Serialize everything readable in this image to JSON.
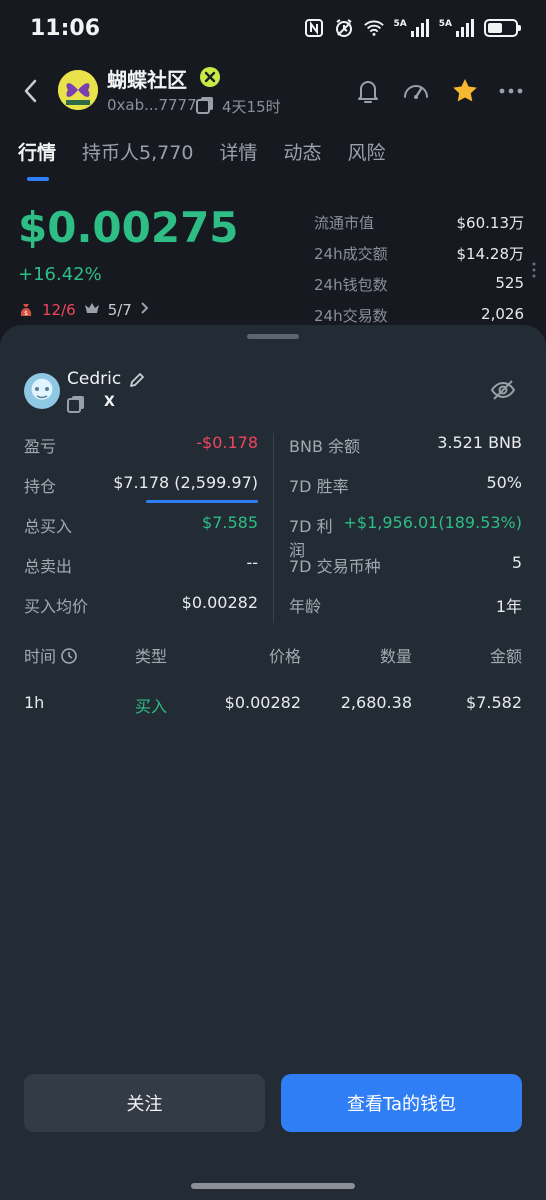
{
  "status_bar": {
    "time": "11:06",
    "signal1_label": "5A",
    "signal2_label": "5A",
    "icons": [
      "nfc-icon",
      "alarm-icon",
      "wifi-icon",
      "signal-icon",
      "signal-icon",
      "battery-icon"
    ]
  },
  "header": {
    "token_name": "蝴蝶社区",
    "address": "0xab...7777",
    "age": "4天15时",
    "icons": [
      "back-icon",
      "bell-icon",
      "gauge-icon",
      "star-icon",
      "more-icon"
    ],
    "star_color": "#f5b82e"
  },
  "tabs": [
    {
      "label": "行情",
      "active": true
    },
    {
      "label": "持币人5,770"
    },
    {
      "label": "详情"
    },
    {
      "label": "动态"
    },
    {
      "label": "风险"
    }
  ],
  "price": {
    "value": "$0.00275",
    "change": "+16.42%",
    "chip1": "12/6",
    "chip2": "5/7"
  },
  "stats": [
    {
      "label": "流通市值",
      "value": "$60.13万"
    },
    {
      "label": "24h成交额",
      "value": "$14.28万"
    },
    {
      "label": "24h钱包数",
      "value": "525"
    },
    {
      "label": "24h交易数",
      "value": "2,026"
    }
  ],
  "wallet": {
    "name": "Cedric",
    "social": "X",
    "left": [
      {
        "label": "盈亏",
        "value": "-$0.178"
      },
      {
        "label": "持仓",
        "value": "$7.178 (2,599.97)"
      },
      {
        "label": "总买入",
        "value": "$7.585"
      },
      {
        "label": "总卖出",
        "value": "--"
      },
      {
        "label": "买入均价",
        "value": "$0.00282"
      }
    ],
    "right": [
      {
        "label": "BNB 余额",
        "value": "3.521 BNB"
      },
      {
        "label": "7D 胜率",
        "value": "50%"
      },
      {
        "label": "7D 利润",
        "value": "+$1,956.01(189.53%)"
      },
      {
        "label": "7D 交易币种",
        "value": "5"
      },
      {
        "label": "年龄",
        "value": "1年"
      }
    ]
  },
  "trades": {
    "headers": [
      "时间",
      "类型",
      "价格",
      "数量",
      "金额"
    ],
    "rows": [
      {
        "time": "1h",
        "type": "买入",
        "price": "$0.00282",
        "amount": "2,680.38",
        "total": "$7.582"
      }
    ]
  },
  "actions": {
    "follow": "关注",
    "view_wallet": "查看Ta的钱包"
  },
  "colors": {
    "up": "#2ebd85",
    "down": "#f0455e",
    "accent": "#2f7ef5"
  }
}
